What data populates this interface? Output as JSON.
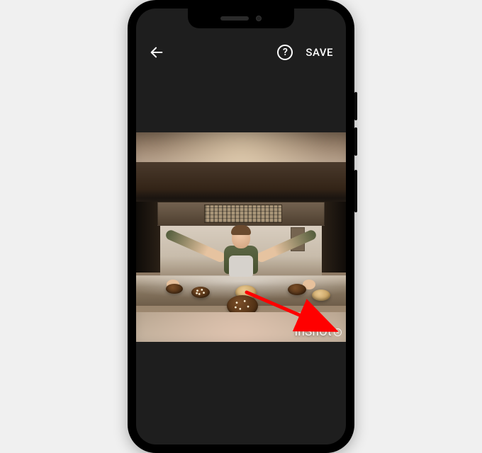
{
  "topbar": {
    "back_icon": "back-arrow",
    "help_icon_glyph": "?",
    "save_label": "SAVE"
  },
  "watermark": {
    "text": "InShOt",
    "close_glyph": "×"
  },
  "annotation": {
    "arrow_color": "#ff0000"
  }
}
